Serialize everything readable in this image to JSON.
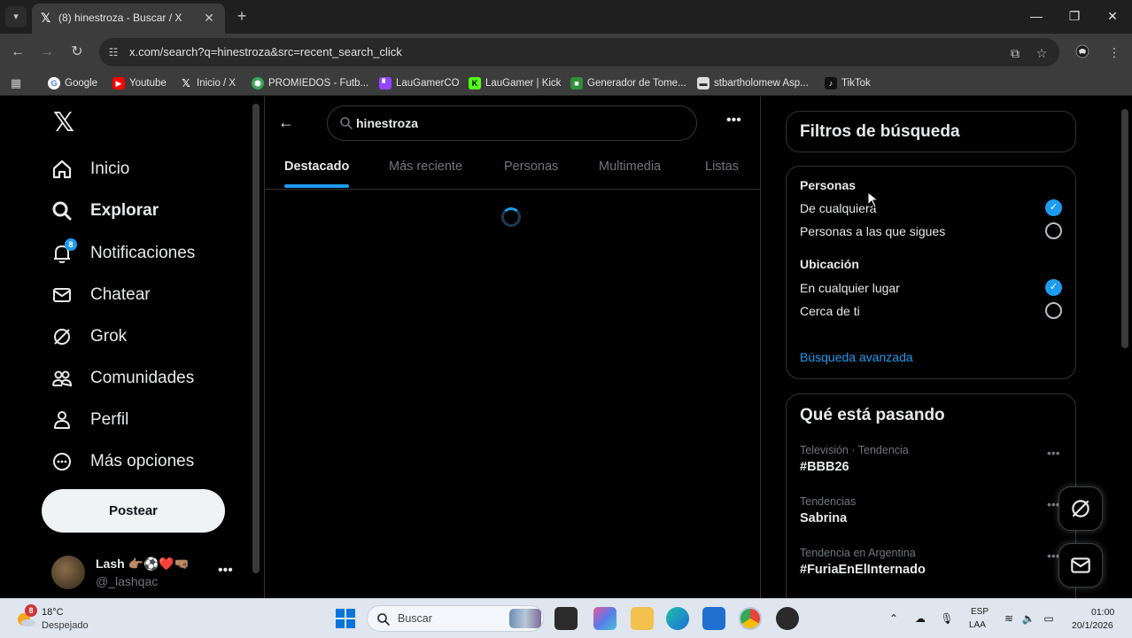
{
  "browser": {
    "tab_title": "(8) hinestroza - Buscar / X",
    "url": "x.com/search?q=hinestroza&src=recent_search_click",
    "bookmarks": [
      {
        "label": "Google",
        "icon": "google-icon",
        "color": "#4285f4"
      },
      {
        "label": "Youtube",
        "icon": "youtube-icon",
        "color": "#ff0000"
      },
      {
        "label": "Inicio / X",
        "icon": "x-icon",
        "color": "#000000"
      },
      {
        "label": "PROMIEDOS - Futb...",
        "icon": "promiedos-icon",
        "color": "#3aa657"
      },
      {
        "label": "LauGamerCO",
        "icon": "twitch-icon",
        "color": "#9146ff"
      },
      {
        "label": "LauGamer | Kick",
        "icon": "kick-icon",
        "color": "#53fc18"
      },
      {
        "label": "Generador de Tome...",
        "icon": "generator-icon",
        "color": "#2f8f3a"
      },
      {
        "label": "stbartholomew Asp...",
        "icon": "stbartholomew-icon",
        "color": "#dddddd"
      },
      {
        "label": "TikTok",
        "icon": "tiktok-icon",
        "color": "#111111"
      }
    ]
  },
  "nav": {
    "items": [
      {
        "label": "Inicio",
        "icon": "home-icon"
      },
      {
        "label": "Explorar",
        "icon": "search-icon"
      },
      {
        "label": "Notificaciones",
        "icon": "bell-icon",
        "badge": "8"
      },
      {
        "label": "Chatear",
        "icon": "mail-icon"
      },
      {
        "label": "Grok",
        "icon": "grok-icon"
      },
      {
        "label": "Comunidades",
        "icon": "communities-icon"
      },
      {
        "label": "Perfil",
        "icon": "profile-icon"
      },
      {
        "label": "Más opciones",
        "icon": "more-options-icon"
      }
    ],
    "post_label": "Postear",
    "account": {
      "name": "Lash 👉🏽⚽❤️🤜🏽",
      "handle": "@_lashqac"
    }
  },
  "search": {
    "query": "hinestroza",
    "tabs": [
      "Destacado",
      "Más reciente",
      "Personas",
      "Multimedia",
      "Listas"
    ],
    "active_tab": "Destacado"
  },
  "filters": {
    "title": "Filtros de búsqueda",
    "people_heading": "Personas",
    "people_options": [
      {
        "label": "De cualquiera",
        "checked": true
      },
      {
        "label": "Personas a las que sigues",
        "checked": false
      }
    ],
    "location_heading": "Ubicación",
    "location_options": [
      {
        "label": "En cualquier lugar",
        "checked": true
      },
      {
        "label": "Cerca de ti",
        "checked": false
      }
    ],
    "advanced_link": "Búsqueda avanzada"
  },
  "trends": {
    "title": "Qué está pasando",
    "items": [
      {
        "meta": "Televisión · Tendencia",
        "name": "#BBB26"
      },
      {
        "meta": "Tendencias",
        "name": "Sabrina"
      },
      {
        "meta": "Tendencia en Argentina",
        "name": "#FuriaEnElInternado"
      }
    ]
  },
  "taskbar": {
    "weather_temp": "18°C",
    "weather_desc": "Despejado",
    "weather_badge": "8",
    "search_placeholder": "Buscar",
    "lang_top": "ESP",
    "lang_bottom": "LAA",
    "time": "01:00",
    "date": "20/1/2026"
  },
  "colors": {
    "accent": "#1d9bf0",
    "background": "#000000",
    "muted_text": "#71767b"
  }
}
